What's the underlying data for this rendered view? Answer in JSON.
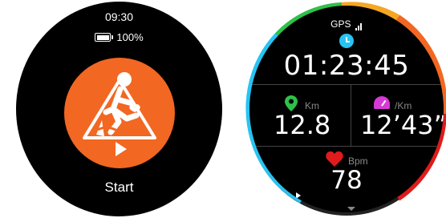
{
  "left_watch": {
    "time": "09:30",
    "battery_percent": "100%",
    "battery_level": 1.0,
    "start_label": "Start",
    "accent_color": "#f26722",
    "icons": [
      "hiking-icon",
      "play-icon",
      "battery-icon"
    ]
  },
  "right_watch": {
    "gps_label": "GPS",
    "duration": "01:23:45",
    "distance": {
      "value": "12.8",
      "unit": "Km"
    },
    "pace": {
      "value": "12’43”",
      "unit": "/Km"
    },
    "heart_rate": {
      "value": "78",
      "unit": "Bpm"
    },
    "ring_colors": [
      "#27c4f2",
      "#30c04a",
      "#f5a623",
      "#f26722",
      "#e01b1b"
    ],
    "icons": [
      "signal-icon",
      "clock-icon",
      "location-pin-icon",
      "speedometer-icon",
      "heart-icon",
      "arrow-right-icon",
      "chevron-down-icon"
    ]
  }
}
